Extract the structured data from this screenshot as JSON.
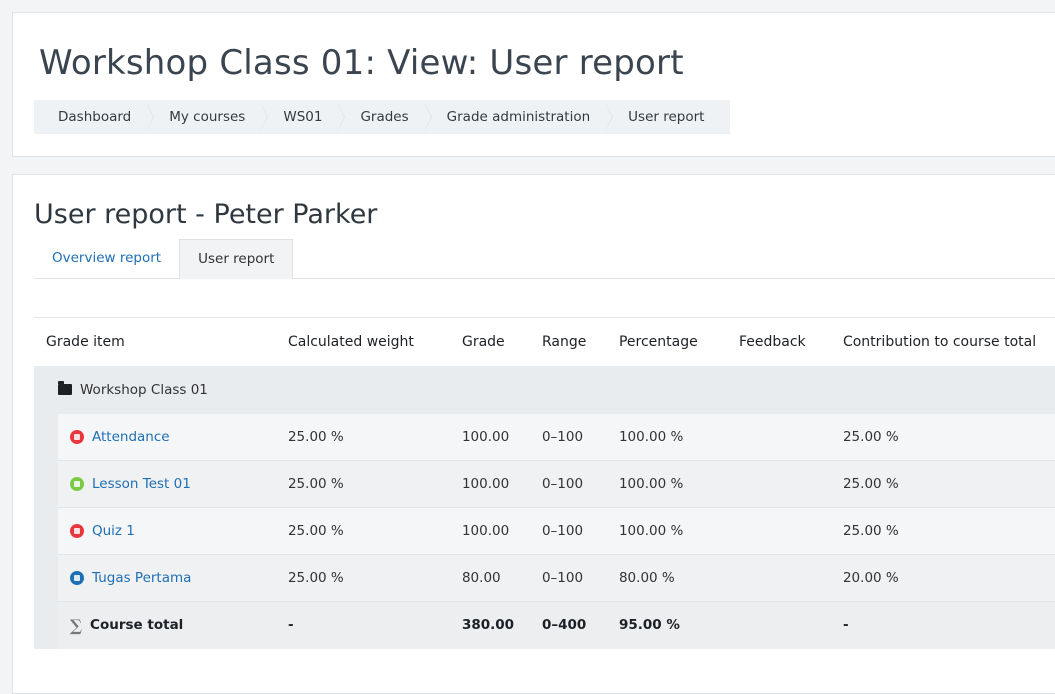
{
  "page": {
    "title": "Workshop Class 01: View: User report"
  },
  "breadcrumb": [
    "Dashboard",
    "My courses",
    "WS01",
    "Grades",
    "Grade administration",
    "User report"
  ],
  "report": {
    "title": "User report - Peter Parker",
    "tabs": [
      "Overview report",
      "User report"
    ],
    "active_tab": "User report"
  },
  "table": {
    "headers": [
      "Grade item",
      "Calculated weight",
      "Grade",
      "Range",
      "Percentage",
      "Feedback",
      "Contribution to course total"
    ],
    "category": "Workshop Class 01",
    "items": [
      {
        "name": "Attendance",
        "icon": "attendance-icon",
        "icon_color": "#e8383d",
        "weight": "25.00 %",
        "grade": "100.00",
        "range": "0–100",
        "percentage": "100.00 %",
        "feedback": "",
        "contribution": "25.00 %"
      },
      {
        "name": "Lesson Test 01",
        "icon": "lesson-icon",
        "icon_color": "#7ac943",
        "weight": "25.00 %",
        "grade": "100.00",
        "range": "0–100",
        "percentage": "100.00 %",
        "feedback": "",
        "contribution": "25.00 %"
      },
      {
        "name": "Quiz 1",
        "icon": "quiz-icon",
        "icon_color": "#e8383d",
        "weight": "25.00 %",
        "grade": "100.00",
        "range": "0–100",
        "percentage": "100.00 %",
        "feedback": "",
        "contribution": "25.00 %"
      },
      {
        "name": "Tugas Pertama",
        "icon": "assignment-icon",
        "icon_color": "#1f6fb5",
        "weight": "25.00 %",
        "grade": "80.00",
        "range": "0–100",
        "percentage": "80.00 %",
        "feedback": "",
        "contribution": "20.00 %"
      }
    ],
    "total": {
      "name": "Course total",
      "weight": "-",
      "grade": "380.00",
      "range": "0–400",
      "percentage": "95.00 %",
      "feedback": "",
      "contribution": "-"
    }
  },
  "colors": {
    "link": "#1f6fb5",
    "category_bg": "#e9ecef"
  }
}
